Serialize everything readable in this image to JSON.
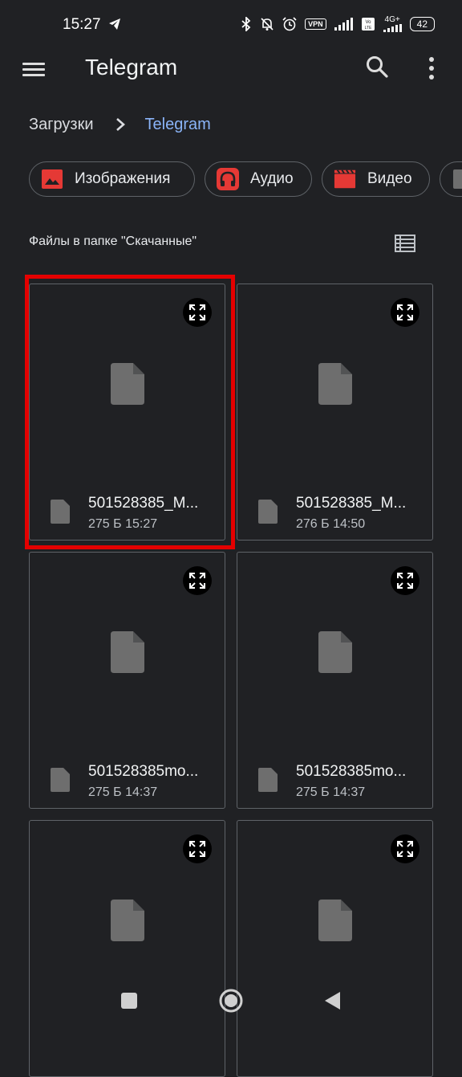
{
  "status_bar": {
    "time": "15:27",
    "vpn": "VPN",
    "network": "4G+",
    "battery": "42",
    "icons": [
      "telegram-send-icon",
      "bluetooth-icon",
      "mute-icon",
      "alarm-icon",
      "vpn-icon",
      "signal-icon",
      "volte-icon",
      "signal-icon",
      "battery-icon"
    ]
  },
  "toolbar": {
    "title": "Telegram",
    "menu_icon": "menu-icon",
    "search_icon": "search-icon",
    "more_icon": "more-vert-icon"
  },
  "breadcrumb": {
    "root": "Загрузки",
    "current": "Telegram"
  },
  "chips": [
    {
      "label": "Изображения",
      "icon": "image-icon",
      "color": "#e53935"
    },
    {
      "label": "Аудио",
      "icon": "headphones-icon",
      "color": "#e53935"
    },
    {
      "label": "Видео",
      "icon": "movie-icon",
      "color": "#e53935"
    }
  ],
  "section": {
    "title": "Файлы в папке \"Скачанные\"",
    "view_icon": "list-view-icon"
  },
  "files": [
    {
      "name": "501528385_M...",
      "info": "275 Б 15:27"
    },
    {
      "name": "501528385_M...",
      "info": "276 Б 14:50"
    },
    {
      "name": "501528385mo...",
      "info": "275 Б 14:37"
    },
    {
      "name": "501528385mo...",
      "info": "275 Б 14:37"
    },
    {
      "name": "",
      "info": ""
    },
    {
      "name": "",
      "info": ""
    }
  ],
  "colors": {
    "background": "#202124",
    "accent": "#8ab4f8",
    "chip_icon": "#e53935",
    "highlight": "#e40000",
    "file_icon": "#6e6e6e"
  },
  "navigation": [
    "recents-square-icon",
    "home-circle-icon",
    "back-triangle-icon"
  ]
}
